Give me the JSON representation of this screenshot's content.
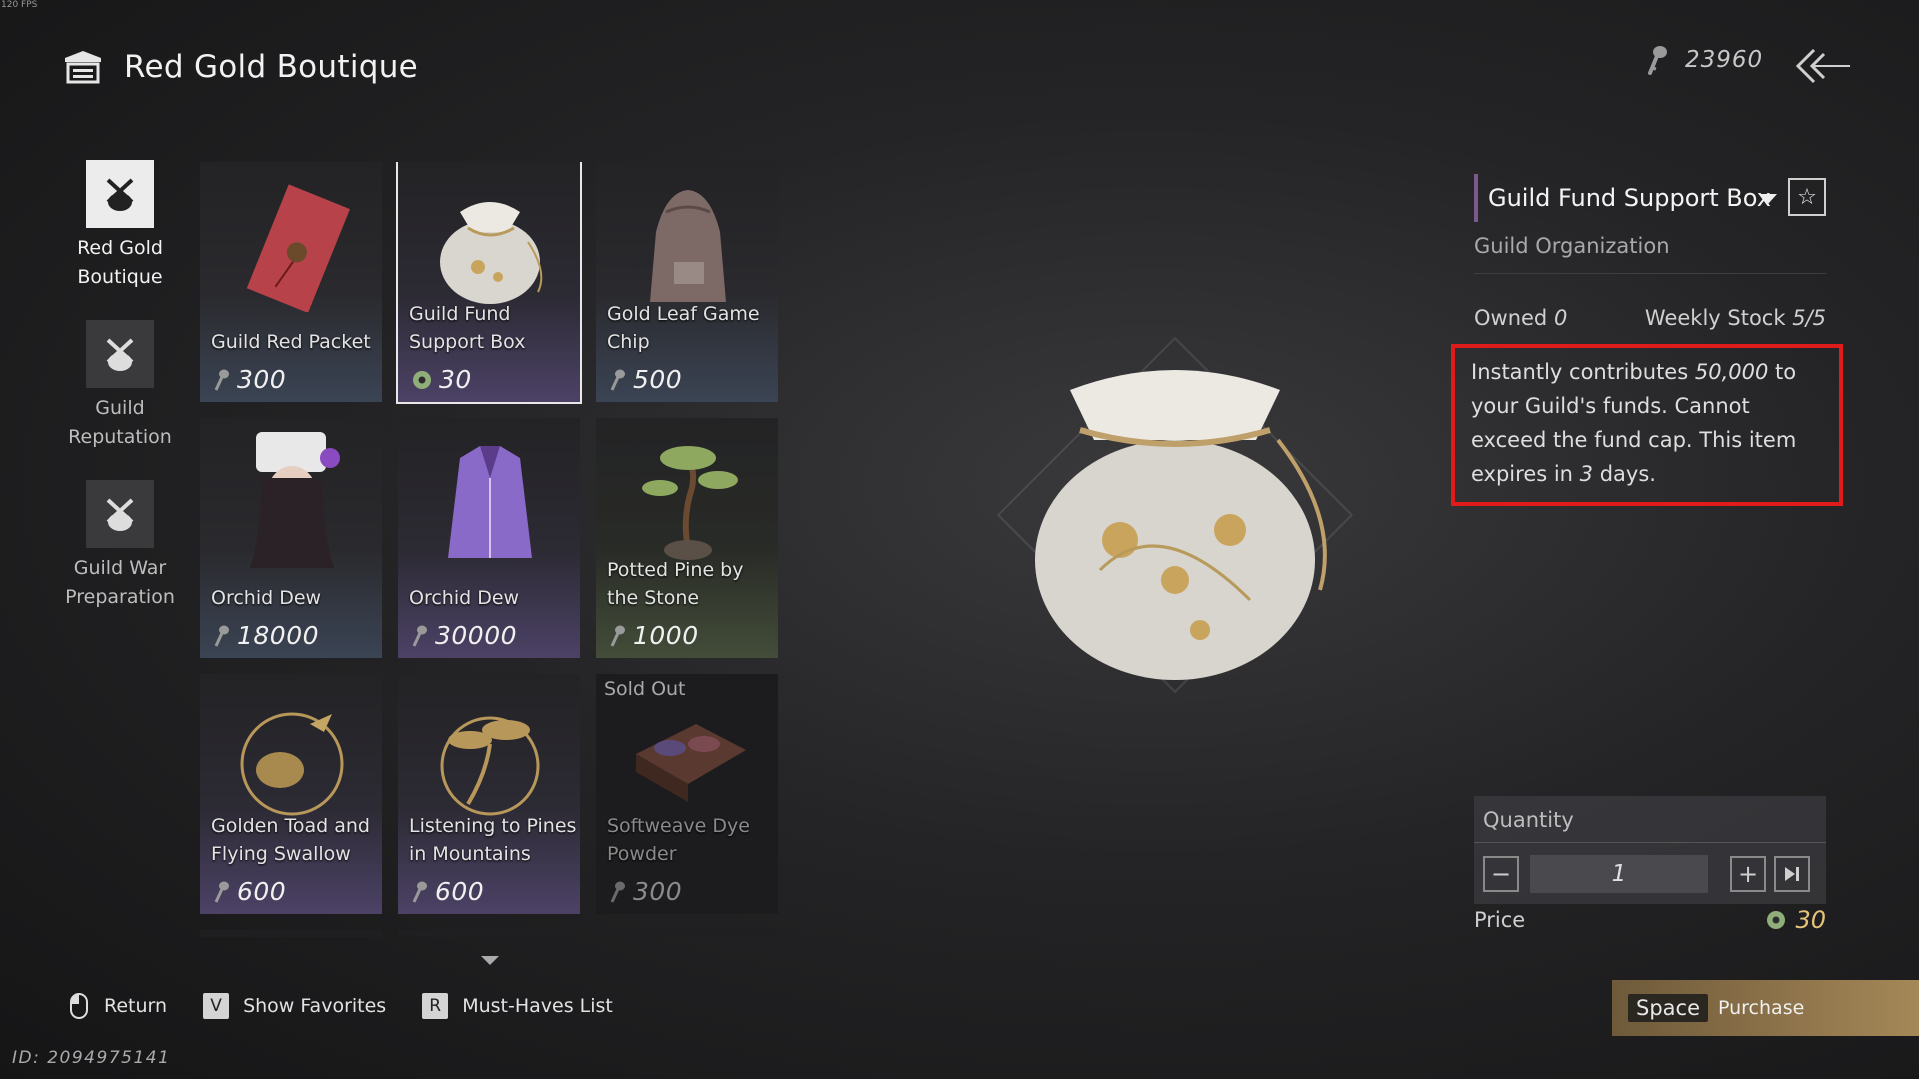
{
  "fps": "120 FPS",
  "header": {
    "title": "Red Gold Boutique",
    "shop_icon": "shop-icon"
  },
  "currency": {
    "amount": "23960",
    "icon": "key-icon"
  },
  "nav": [
    {
      "label_1": "Red Gold",
      "label_2": "Boutique",
      "active": true
    },
    {
      "label_1": "Guild",
      "label_2": "Reputation",
      "active": false
    },
    {
      "label_1": "Guild War",
      "label_2": "Preparation",
      "active": false
    }
  ],
  "items": [
    {
      "name": "Guild Red Packet",
      "price": "300",
      "currency": "key",
      "art": "red-envelope"
    },
    {
      "name": "Guild Fund Support Box",
      "price": "30",
      "currency": "jade",
      "art": "white-pouch",
      "selected": true
    },
    {
      "name": "Gold Leaf Game Chip",
      "price": "500",
      "currency": "key",
      "art": "backpack"
    },
    {
      "name": "Orchid Dew",
      "price": "18000",
      "currency": "key",
      "art": "portrait"
    },
    {
      "name": "Orchid Dew",
      "price": "30000",
      "currency": "key",
      "art": "robe"
    },
    {
      "name": "Potted Pine by the Stone",
      "price": "1000",
      "currency": "key",
      "art": "bonsai"
    },
    {
      "name": "Golden Toad and Flying Swallow",
      "price": "600",
      "currency": "key",
      "art": "toad"
    },
    {
      "name": "Listening to Pines in Mountains",
      "price": "600",
      "currency": "key",
      "art": "pines"
    },
    {
      "name": "Softweave Dye Powder",
      "price": "300",
      "currency": "key",
      "art": "dye-box",
      "status": "Sold Out"
    }
  ],
  "detail": {
    "title": "Guild Fund Support Box",
    "category": "Guild Organization",
    "owned_label": "Owned",
    "owned_value": "0",
    "stock_label": "Weekly Stock",
    "stock_value": "5/5",
    "desc_1": "Instantly contributes ",
    "desc_amount": "50,000",
    "desc_2": " to your Guild's funds. Cannot exceed the fund cap. This item expires in ",
    "desc_days": "3",
    "desc_3": " days."
  },
  "quantity": {
    "label": "Quantity",
    "value": "1"
  },
  "price": {
    "label": "Price",
    "value": "30"
  },
  "purchase": {
    "key": "Space",
    "label": "Purchase"
  },
  "hints": [
    {
      "key": "mouse",
      "label": "Return"
    },
    {
      "key": "V",
      "label": "Show Favorites"
    },
    {
      "key": "R",
      "label": "Must-Haves List"
    }
  ],
  "player_id": "ID: 2094975141",
  "colors": {
    "highlight_border": "#e01b1b",
    "price_gold": "#e4c27a",
    "purchase_gold": "#a48858"
  }
}
